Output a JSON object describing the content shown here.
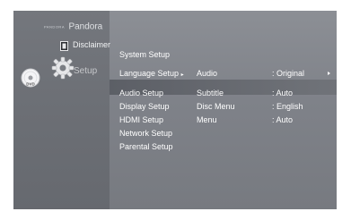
{
  "brand": {
    "prefix": "PANDORA",
    "name": "Pandora"
  },
  "top_items": [
    {
      "label": "Disclaimer"
    }
  ],
  "current_section": {
    "label": "Setup"
  },
  "icons": {
    "dvd": "dvd-disc-icon",
    "setup": "gear-icon",
    "disclaimer": "document-icon"
  },
  "setup_menu": [
    {
      "label": "System Setup"
    },
    {
      "label": "Language Setup",
      "selected": true,
      "submenu_marker": "▸"
    },
    {
      "label": "Audio Setup"
    },
    {
      "label": "Display Setup"
    },
    {
      "label": "HDMI Setup"
    },
    {
      "label": "Network Setup"
    },
    {
      "label": "Parental Setup"
    }
  ],
  "language_options": [
    {
      "name": "Audio",
      "value": ": Original",
      "has_submenu": true
    },
    {
      "name": "Subtitle",
      "value": ": Auto"
    },
    {
      "name": "Disc Menu",
      "value": ": English"
    },
    {
      "name": "Menu",
      "value": ": Auto"
    }
  ],
  "colors": {
    "panel": "#8a8d93",
    "left_panel": "#6e7177",
    "highlight": "#5e6168",
    "text": "#ffffff"
  }
}
